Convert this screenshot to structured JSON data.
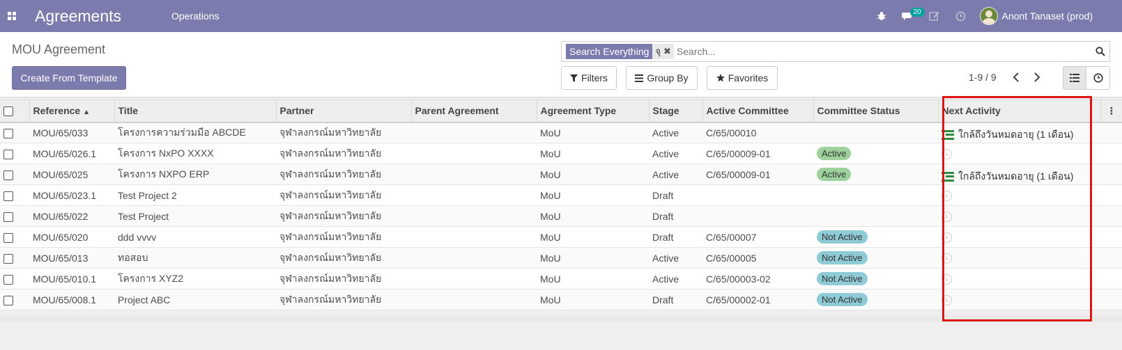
{
  "navbar": {
    "app_title": "Agreements",
    "menu_operations": "Operations",
    "messages_count": "20",
    "user_name": "Anont Tanaset (prod)"
  },
  "control": {
    "breadcrumb": "MOU Agreement",
    "create_button": "Create From Template",
    "search_facet_label": "Search Everything",
    "search_facet_value": "จุ",
    "search_placeholder": "Search...",
    "filters_label": "Filters",
    "groupby_label": "Group By",
    "favorites_label": "Favorites",
    "pager": "1-9 / 9"
  },
  "columns": [
    "Reference",
    "Title",
    "Partner",
    "Parent Agreement",
    "Agreement Type",
    "Stage",
    "Active Committee",
    "Committee Status",
    "Next Activity"
  ],
  "rows": [
    {
      "ref": "MOU/65/033",
      "title": "โครงการความร่วมมือ ABCDE",
      "partner": "จุฬาลงกรณ์มหาวิทยาลัย",
      "parent": "",
      "type": "MoU",
      "stage": "Active",
      "committee": "C/65/00010",
      "status": "",
      "activity": "ใกล้ถึงวันหมดอายุ (1 เดือน)"
    },
    {
      "ref": "MOU/65/026.1",
      "title": "โครงการ NxPO XXXX",
      "partner": "จุฬาลงกรณ์มหาวิทยาลัย",
      "parent": "",
      "type": "MoU",
      "stage": "Active",
      "committee": "C/65/00009-01",
      "status": "Active",
      "activity": ""
    },
    {
      "ref": "MOU/65/025",
      "title": "โครงการ NXPO ERP",
      "partner": "จุฬาลงกรณ์มหาวิทยาลัย",
      "parent": "",
      "type": "MoU",
      "stage": "Active",
      "committee": "C/65/00009-01",
      "status": "Active",
      "activity": "ใกล้ถึงวันหมดอายุ (1 เดือน)"
    },
    {
      "ref": "MOU/65/023.1",
      "title": "Test Project 2",
      "partner": "จุฬาลงกรณ์มหาวิทยาลัย",
      "parent": "",
      "type": "MoU",
      "stage": "Draft",
      "committee": "",
      "status": "",
      "activity": ""
    },
    {
      "ref": "MOU/65/022",
      "title": "Test Project",
      "partner": "จุฬาลงกรณ์มหาวิทยาลัย",
      "parent": "",
      "type": "MoU",
      "stage": "Draft",
      "committee": "",
      "status": "",
      "activity": ""
    },
    {
      "ref": "MOU/65/020",
      "title": "ddd vvvv",
      "partner": "จุฬาลงกรณ์มหาวิทยาลัย",
      "parent": "",
      "type": "MoU",
      "stage": "Draft",
      "committee": "C/65/00007",
      "status": "Not Active",
      "activity": ""
    },
    {
      "ref": "MOU/65/013",
      "title": "ทอสอบ",
      "partner": "จุฬาลงกรณ์มหาวิทยาลัย",
      "parent": "",
      "type": "MoU",
      "stage": "Active",
      "committee": "C/65/00005",
      "status": "Not Active",
      "activity": ""
    },
    {
      "ref": "MOU/65/010.1",
      "title": "โครงการ XYZ2",
      "partner": "จุฬาลงกรณ์มหาวิทยาลัย",
      "parent": "",
      "type": "MoU",
      "stage": "Active",
      "committee": "C/65/00003-02",
      "status": "Not Active",
      "activity": ""
    },
    {
      "ref": "MOU/65/008.1",
      "title": "Project ABC",
      "partner": "จุฬาลงกรณ์มหาวิทยาลัย",
      "parent": "",
      "type": "MoU",
      "stage": "Draft",
      "committee": "C/65/00002-01",
      "status": "Not Active",
      "activity": ""
    }
  ],
  "colors": {
    "brand": "#7c7bad",
    "status_active": "#9dd29d",
    "status_not_active": "#8fcbd6",
    "activity_icon": "#2f8a3f",
    "highlight": "#e01313"
  }
}
